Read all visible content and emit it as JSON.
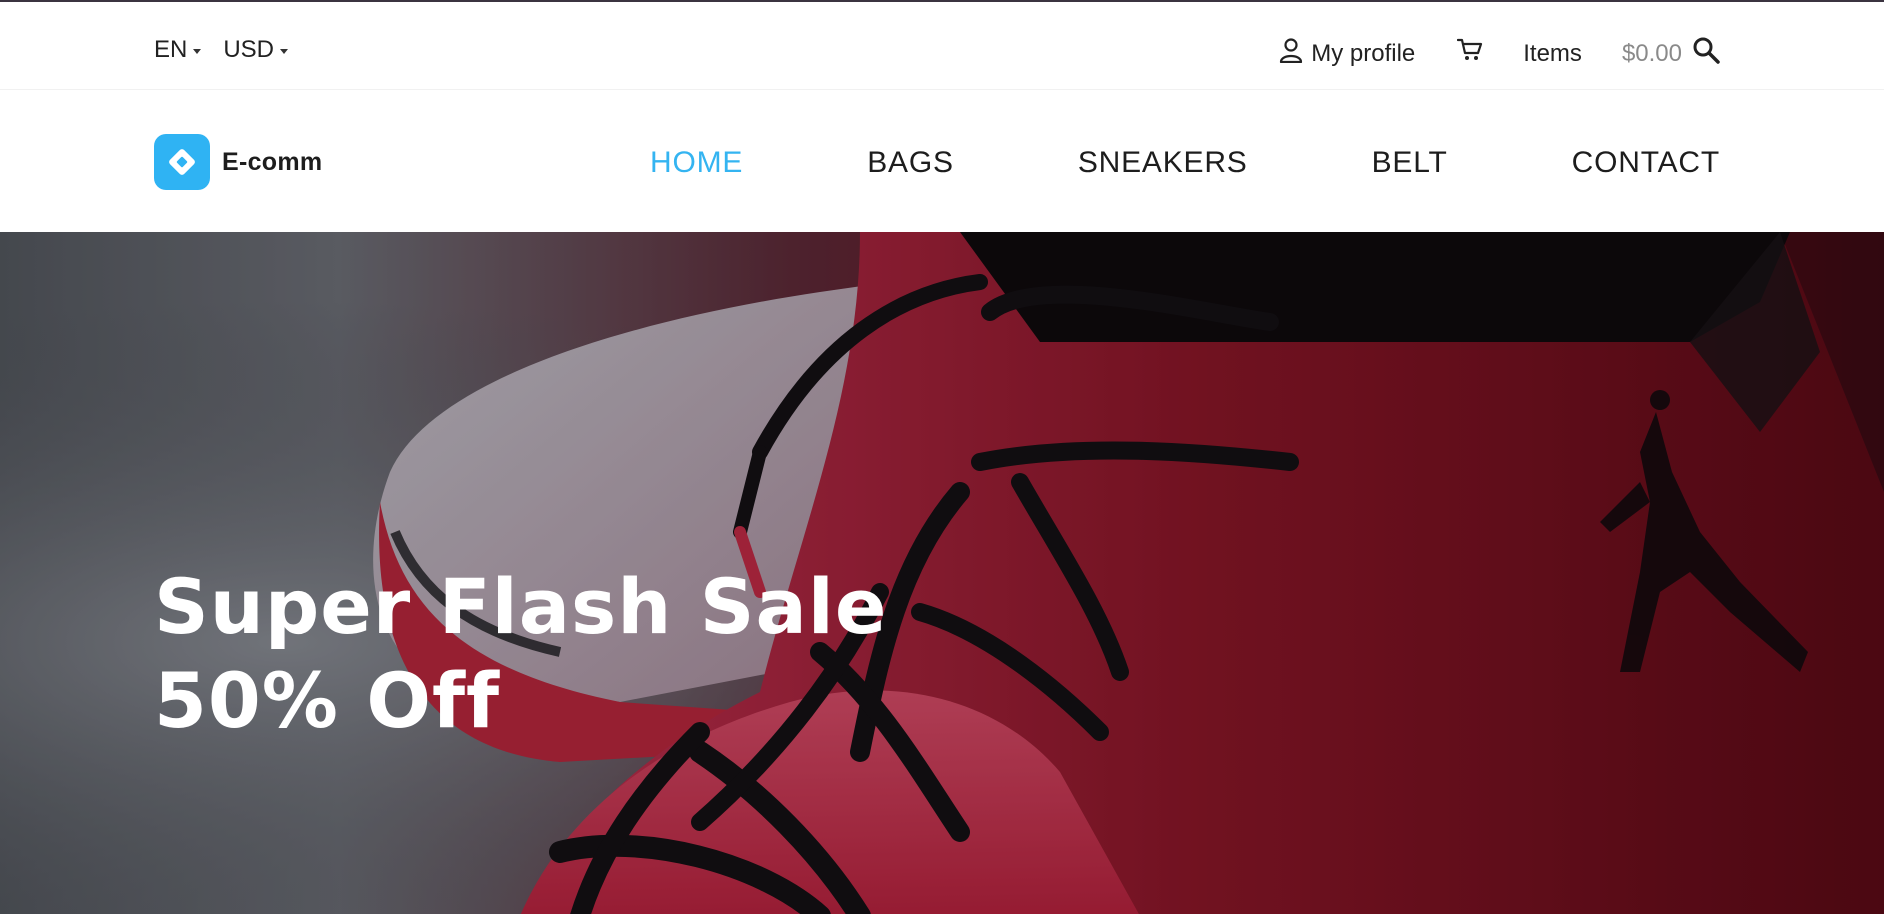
{
  "topbar": {
    "language": "EN",
    "currency": "USD",
    "profile_label": "My profile",
    "items_label": "Items",
    "cart_total": "$0.00",
    "icons": {
      "profile": "user-icon",
      "cart": "cart-icon",
      "search": "search-icon"
    }
  },
  "brand": {
    "name": "E-comm",
    "color": "#2fb3f3"
  },
  "nav": {
    "items": [
      {
        "label": "HOME",
        "active": true
      },
      {
        "label": "BAGS",
        "active": false
      },
      {
        "label": "SNEAKERS",
        "active": false
      },
      {
        "label": "BELT",
        "active": false
      },
      {
        "label": "CONTACT",
        "active": false
      }
    ],
    "active_color": "#34b4f1"
  },
  "hero": {
    "title_line1": "Super Flash Sale",
    "title_line2": "50% Off",
    "background": "red-sneaker-photo"
  }
}
